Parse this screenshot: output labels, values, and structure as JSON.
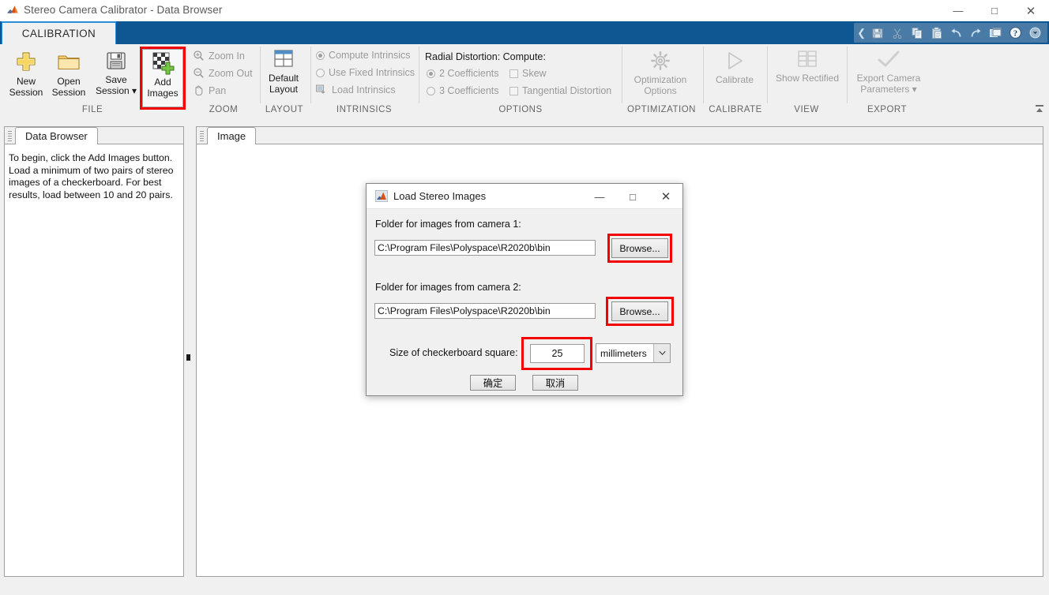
{
  "window": {
    "title": "Stereo Camera Calibrator - Data Browser",
    "minimize": "—",
    "maximize": "□",
    "close": "✕",
    "app_icon": "matlab-membrane-icon"
  },
  "tabs": {
    "calibration": "CALIBRATION"
  },
  "quick_access": {
    "handle": "❮",
    "items": [
      {
        "name": "save-icon",
        "tip": "Save"
      },
      {
        "name": "cut-icon",
        "tip": "Cut"
      },
      {
        "name": "copy-icon",
        "tip": "Copy"
      },
      {
        "name": "paste-icon",
        "tip": "Paste"
      },
      {
        "name": "undo-icon",
        "tip": "Undo"
      },
      {
        "name": "redo-icon",
        "tip": "Redo"
      },
      {
        "name": "layout-icon",
        "tip": "Layout"
      },
      {
        "name": "help-icon",
        "tip": "Help"
      },
      {
        "name": "chevron-down-icon",
        "tip": "More"
      }
    ]
  },
  "ribbon": {
    "collapse_arrow": "collapse-ribbon-icon",
    "groups": {
      "file": {
        "label": "FILE",
        "buttons": [
          {
            "line1": "New",
            "line2": "Session",
            "icon": "plus-icon"
          },
          {
            "line1": "Open",
            "line2": "Session",
            "icon": "folder-icon"
          },
          {
            "line1": "Save",
            "line2": "Session ▾",
            "icon": "floppy-disk-icon"
          },
          {
            "line1": "Add",
            "line2": "Images",
            "icon": "add-images-icon"
          }
        ]
      },
      "zoom": {
        "label": "ZOOM",
        "items": [
          {
            "label": "Zoom In",
            "icon": "zoom-in-icon"
          },
          {
            "label": "Zoom Out",
            "icon": "zoom-out-icon"
          },
          {
            "label": "Pan",
            "icon": "pan-hand-icon"
          }
        ]
      },
      "layout": {
        "label": "LAYOUT",
        "button": {
          "line1": "Default",
          "line2": "Layout",
          "icon": "default-layout-icon"
        }
      },
      "intrinsics": {
        "label": "INTRINSICS",
        "items": [
          {
            "label": "Compute Intrinsics",
            "type": "radio",
            "checked": true
          },
          {
            "label": "Use Fixed Intrinsics",
            "type": "radio",
            "checked": false
          },
          {
            "label": "Load Intrinsics",
            "type": "icon-action",
            "icon": "load-intrinsics-icon"
          }
        ]
      },
      "options": {
        "label": "OPTIONS",
        "header": "Radial Distortion: Compute:",
        "items": [
          {
            "label": "2 Coefficients",
            "type": "radio",
            "checked": true
          },
          {
            "label": "Skew",
            "type": "checkbox",
            "checked": false
          },
          {
            "label": "3 Coefficients",
            "type": "radio",
            "checked": false
          },
          {
            "label": "Tangential Distortion",
            "type": "checkbox",
            "checked": false
          }
        ]
      },
      "optimization": {
        "label": "OPTIMIZATION",
        "button": {
          "line1": "Optimization",
          "line2": "Options",
          "icon": "gear-icon"
        }
      },
      "calibrate": {
        "label": "CALIBRATE",
        "button": {
          "line1": "Calibrate",
          "line2": "",
          "icon": "play-triangle-icon"
        }
      },
      "view": {
        "label": "VIEW",
        "button": {
          "line1": "Show Rectified",
          "line2": "",
          "icon": "rectified-pair-icon"
        }
      },
      "export": {
        "label": "EXPORT",
        "button": {
          "line1": "Export Camera",
          "line2": "Parameters ▾",
          "icon": "checkmark-icon"
        }
      }
    }
  },
  "data_browser": {
    "tab_label": "Data Browser",
    "instructions": "To begin, click the Add Images button. Load a minimum of two pairs of stereo images of a checkerboard. For best results, load between 10 and 20 pairs."
  },
  "image_panel": {
    "tab_label": "Image"
  },
  "dialog": {
    "icon": "matlab-membrane-icon",
    "title": "Load Stereo Images",
    "minimize": "—",
    "maximize": "□",
    "close": "✕",
    "camera1_label": "Folder for images from camera 1:",
    "camera1_path": "C:\\Program Files\\Polyspace\\R2020b\\bin",
    "camera1_browse": "Browse...",
    "camera2_label": "Folder for images from camera 2:",
    "camera2_path": "C:\\Program Files\\Polyspace\\R2020b\\bin",
    "camera2_browse": "Browse...",
    "square_size_label": "Size of checkerboard square:",
    "square_size_value": "25",
    "units_value": "millimeters",
    "units_arrow": "⌄",
    "ok_label": "确定",
    "cancel_label": "取消"
  },
  "annotations": {
    "highlight_color": "#f40000",
    "boxes": [
      {
        "name": "add-images-highlight"
      },
      {
        "name": "browse1-highlight"
      },
      {
        "name": "browse2-highlight"
      },
      {
        "name": "square-size-highlight"
      }
    ]
  },
  "colors": {
    "ribbon_tab_bar": "#0f5792",
    "tab_accent": "#2a8fd8",
    "ribbon_bg": "#f0f0f0",
    "qat_bg": "#4a7ba7"
  }
}
